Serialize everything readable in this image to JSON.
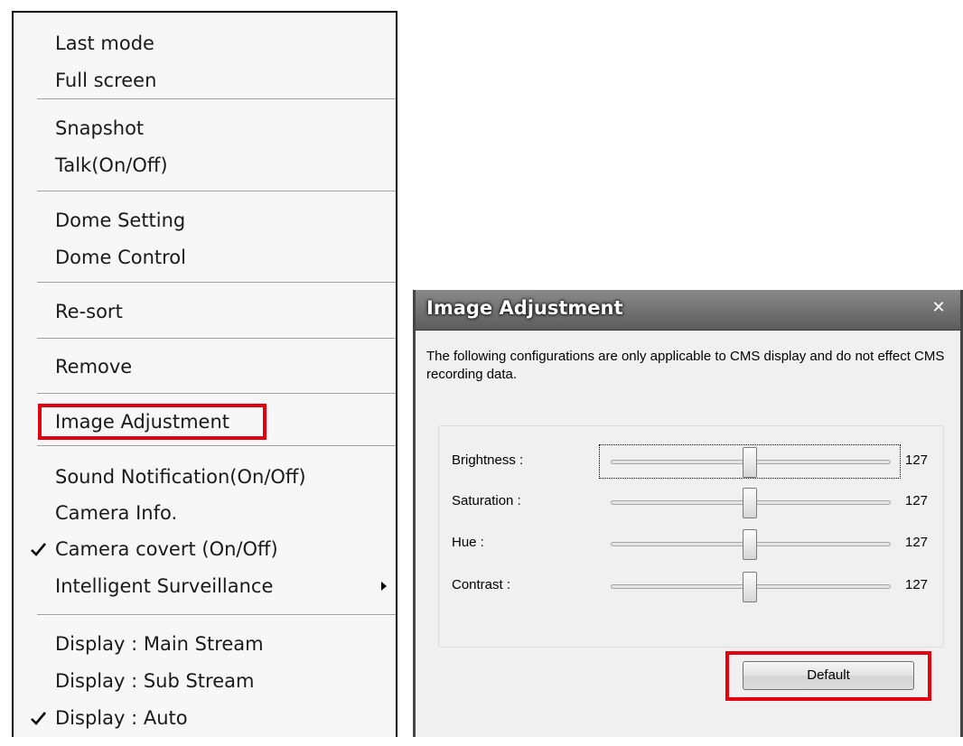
{
  "menu": {
    "items": [
      {
        "label": "Last mode"
      },
      {
        "label": "Full screen"
      },
      {
        "label": "Snapshot"
      },
      {
        "label": "Talk(On/Off)"
      },
      {
        "label": "Dome Setting"
      },
      {
        "label": "Dome Control"
      },
      {
        "label": "Re-sort"
      },
      {
        "label": "Remove"
      },
      {
        "label": "Image Adjustment",
        "highlighted": true
      },
      {
        "label": "Sound Notification(On/Off)"
      },
      {
        "label": "Camera Info."
      },
      {
        "label": "Camera covert (On/Off)",
        "checked": true
      },
      {
        "label": "Intelligent Surveillance",
        "has_submenu": true
      },
      {
        "label": "Display : Main Stream"
      },
      {
        "label": "Display : Sub Stream"
      },
      {
        "label": "Display : Auto",
        "checked": true
      }
    ]
  },
  "dialog": {
    "title": "Image Adjustment",
    "close_icon": "close-icon",
    "description": "The following configurations are only applicable to CMS display and do not effect CMS recording data.",
    "sliders": [
      {
        "label": "Brightness :",
        "value": "127",
        "min": 0,
        "max": 255,
        "focused": true
      },
      {
        "label": "Saturation :",
        "value": "127",
        "min": 0,
        "max": 255
      },
      {
        "label": "Hue :",
        "value": "127",
        "min": 0,
        "max": 255
      },
      {
        "label": "Contrast :",
        "value": "127",
        "min": 0,
        "max": 255
      }
    ],
    "default_button": "Default"
  },
  "colors": {
    "highlight_box": "#e3000f",
    "titlebar": "#6e6e6e"
  }
}
